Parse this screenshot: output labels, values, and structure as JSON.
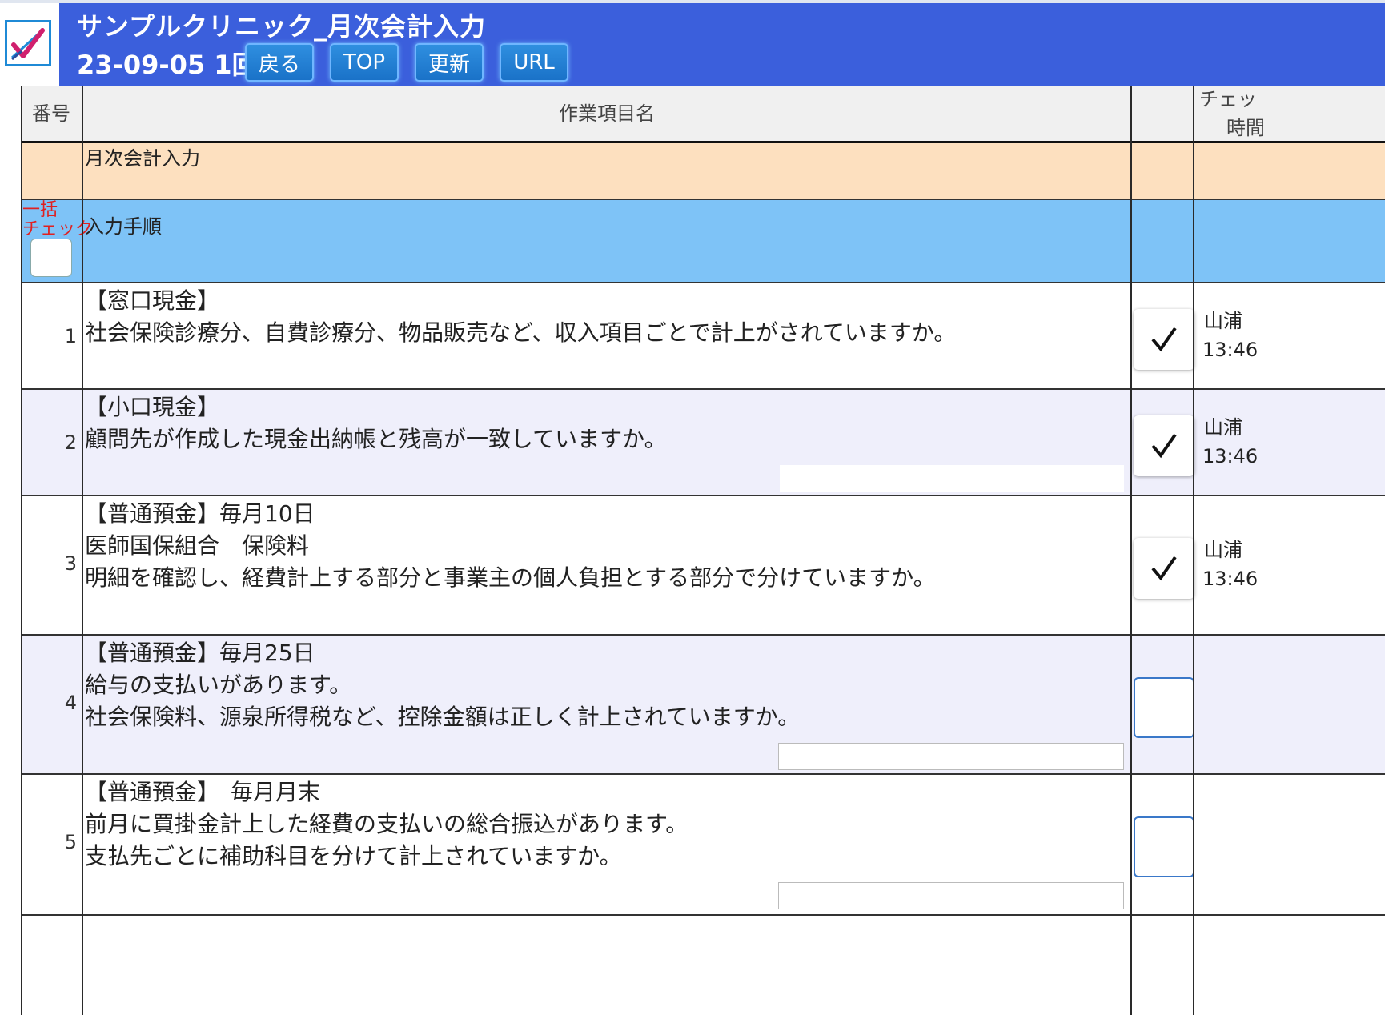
{
  "header": {
    "title": "サンプルクリニック_月次会計入力",
    "date_round": "23-09-05 1回",
    "buttons": [
      "戻る",
      "TOP",
      "更新",
      "URL"
    ]
  },
  "table": {
    "columns": {
      "number": "番号",
      "task": "作業項目名",
      "check_time_1": "チェッ",
      "check_time_2": "時間"
    },
    "group_row": {
      "label": "月次会計入力"
    },
    "section_row": {
      "bulk_label_1": "一括",
      "bulk_label_2": "チェック",
      "label": "入力手順"
    },
    "rows": [
      {
        "no": "1",
        "lines": [
          "【窓口現金】",
          "社会保険診療分、自費診療分、物品販売など、収入項目ごとで計上がされていますか。"
        ],
        "checked": true,
        "checker": "山浦",
        "time": "13:46"
      },
      {
        "no": "2",
        "lines": [
          "【小口現金】",
          "顧問先が作成した現金出納帳と残高が一致していますか。"
        ],
        "checked": true,
        "checker": "山浦",
        "time": "13:46"
      },
      {
        "no": "3",
        "lines": [
          "【普通預金】毎月10日",
          "医師国保組合　保険料",
          "明細を確認し、経費計上する部分と事業主の個人負担とする部分で分けていますか。"
        ],
        "checked": true,
        "checker": "山浦",
        "time": "13:46"
      },
      {
        "no": "4",
        "lines": [
          "【普通預金】毎月25日",
          "給与の支払いがあります。",
          "社会保険料、源泉所得税など、控除金額は正しく計上されていますか。"
        ],
        "checked": false,
        "checker": "",
        "time": ""
      },
      {
        "no": "5",
        "lines": [
          "【普通預金】　毎月月末",
          "前月に買掛金計上した経費の支払いの総合振込があります。",
          "支払先ごとに補助科目を分けて計上されていますか。"
        ],
        "checked": false,
        "checker": "",
        "time": ""
      }
    ]
  },
  "colors": {
    "header_bg": "#3b5fdc",
    "group_bg": "#fde0bf",
    "section_bg": "#7ec3f7",
    "alt_row_bg": "#efeffb",
    "bulk_label": "#e02020"
  },
  "icons": {
    "logo": "checklist-logo-icon",
    "check": "checkmark-icon"
  }
}
